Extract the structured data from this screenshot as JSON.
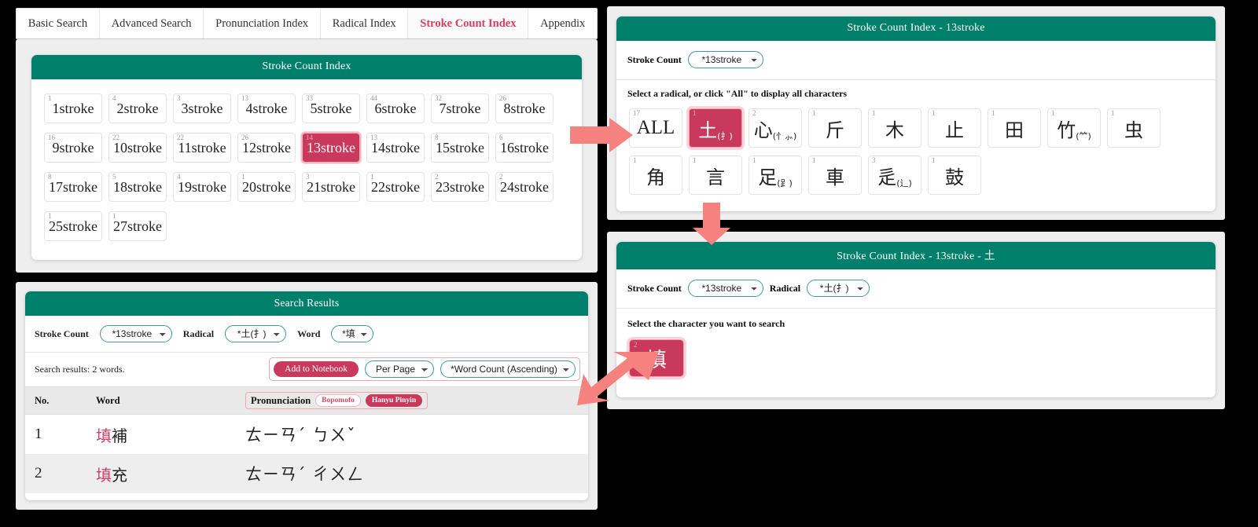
{
  "colors": {
    "teal": "#00806b",
    "crimson": "#c8395b",
    "arrow_pink": "#f5827e",
    "highlight_outline": "#f0a7ae",
    "tab_active": "#e03a5f"
  },
  "tabs": [
    {
      "label": "Basic Search",
      "active": false
    },
    {
      "label": "Advanced Search",
      "active": false
    },
    {
      "label": "Pronunciation Index",
      "active": false
    },
    {
      "label": "Radical Index",
      "active": false
    },
    {
      "label": "Stroke Count Index",
      "active": true
    },
    {
      "label": "Appendix",
      "active": false
    }
  ],
  "stroke_index_panel": {
    "title": "Stroke Count Index",
    "buttons": [
      {
        "label": "1stroke",
        "count": "1",
        "selected": false
      },
      {
        "label": "2stroke",
        "count": "4",
        "selected": false
      },
      {
        "label": "3stroke",
        "count": "3",
        "selected": false
      },
      {
        "label": "4stroke",
        "count": "13",
        "selected": false
      },
      {
        "label": "5stroke",
        "count": "33",
        "selected": false
      },
      {
        "label": "6stroke",
        "count": "44",
        "selected": false
      },
      {
        "label": "7stroke",
        "count": "32",
        "selected": false
      },
      {
        "label": "8stroke",
        "count": "26",
        "selected": false
      },
      {
        "label": "9stroke",
        "count": "16",
        "selected": false
      },
      {
        "label": "10stroke",
        "count": "22",
        "selected": false
      },
      {
        "label": "11stroke",
        "count": "22",
        "selected": false
      },
      {
        "label": "12stroke",
        "count": "26",
        "selected": false
      },
      {
        "label": "13stroke",
        "count": "14",
        "selected": true
      },
      {
        "label": "14stroke",
        "count": "13",
        "selected": false
      },
      {
        "label": "15stroke",
        "count": "8",
        "selected": false
      },
      {
        "label": "16stroke",
        "count": "6",
        "selected": false
      },
      {
        "label": "17stroke",
        "count": "8",
        "selected": false
      },
      {
        "label": "18stroke",
        "count": "5",
        "selected": false
      },
      {
        "label": "19stroke",
        "count": "4",
        "selected": false
      },
      {
        "label": "20stroke",
        "count": "1",
        "selected": false
      },
      {
        "label": "21stroke",
        "count": "3",
        "selected": false
      },
      {
        "label": "22stroke",
        "count": "1",
        "selected": false
      },
      {
        "label": "23stroke",
        "count": "2",
        "selected": false
      },
      {
        "label": "24stroke",
        "count": "2",
        "selected": false
      },
      {
        "label": "25stroke",
        "count": "1",
        "selected": false
      },
      {
        "label": "27stroke",
        "count": "1",
        "selected": false
      }
    ]
  },
  "radical_panel": {
    "title": "Stroke Count Index - 13stroke",
    "stroke_count_label": "Stroke Count",
    "stroke_count_value": "*13stroke",
    "note": "Select a radical, or click \"All\" to display all characters",
    "radicals": [
      {
        "glyph": "ALL",
        "alt": "",
        "count": "17",
        "selected": false,
        "ascii": true
      },
      {
        "glyph": "土",
        "alt": "(扌)",
        "count": "1",
        "selected": true,
        "ascii": false
      },
      {
        "glyph": "心",
        "alt": "(忄⺗)",
        "count": "2",
        "selected": false,
        "ascii": false
      },
      {
        "glyph": "斤",
        "alt": "",
        "count": "1",
        "selected": false,
        "ascii": false
      },
      {
        "glyph": "木",
        "alt": "",
        "count": "1",
        "selected": false,
        "ascii": false
      },
      {
        "glyph": "止",
        "alt": "",
        "count": "1",
        "selected": false,
        "ascii": false
      },
      {
        "glyph": "田",
        "alt": "",
        "count": "1",
        "selected": false,
        "ascii": false
      },
      {
        "glyph": "竹",
        "alt": "(⺮)",
        "count": "1",
        "selected": false,
        "ascii": false
      },
      {
        "glyph": "虫",
        "alt": "",
        "count": "1",
        "selected": false,
        "ascii": false
      },
      {
        "glyph": "角",
        "alt": "",
        "count": "1",
        "selected": false,
        "ascii": false
      },
      {
        "glyph": "言",
        "alt": "",
        "count": "1",
        "selected": false,
        "ascii": false
      },
      {
        "glyph": "足",
        "alt": "(⻊)",
        "count": "1",
        "selected": false,
        "ascii": false
      },
      {
        "glyph": "車",
        "alt": "",
        "count": "1",
        "selected": false,
        "ascii": false
      },
      {
        "glyph": "辵",
        "alt": "(辶)",
        "count": "3",
        "selected": false,
        "ascii": false
      },
      {
        "glyph": "鼓",
        "alt": "",
        "count": "1",
        "selected": false,
        "ascii": false
      }
    ]
  },
  "character_panel": {
    "title": "Stroke Count Index - 13stroke - 土",
    "stroke_count_label": "Stroke Count",
    "stroke_count_value": "*13stroke",
    "radical_label": "Radical",
    "radical_value": "*土(扌)",
    "note": "Select the character you want to search",
    "characters": [
      {
        "glyph": "填",
        "count": "2",
        "selected": true
      }
    ]
  },
  "search_results": {
    "title": "Search Results",
    "filters": {
      "stroke_count_label": "Stroke Count",
      "stroke_count_value": "*13stroke",
      "radical_label": "Radical",
      "radical_value": "*土(扌)",
      "word_label": "Word",
      "word_value": "*填"
    },
    "result_count_text": "Search results: 2 words.",
    "add_to_notebook_label": "Add to Notebook",
    "per_page_value": "Per Page",
    "sort_value": "*Word Count (Ascending)",
    "columns": {
      "no": "No.",
      "word": "Word",
      "pronunciation": "Pronunciation",
      "chip_bopomofo": "Bopomofo",
      "chip_pinyin": "Hanyu Pinyin"
    },
    "rows": [
      {
        "no": "1",
        "word_highlight": "填",
        "word_rest": "補",
        "pronunciation": "ㄊㄧㄢˊ ㄅㄨˇ"
      },
      {
        "no": "2",
        "word_highlight": "填",
        "word_rest": "充",
        "pronunciation": "ㄊㄧㄢˊ ㄔㄨㄥ"
      }
    ]
  }
}
